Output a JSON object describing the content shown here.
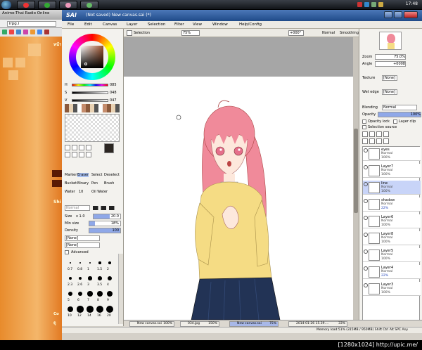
{
  "taskbar": {
    "clock": "17:48"
  },
  "browser": {
    "tab_title": "Anime-Thai Radio Online",
    "address": "irpg.i",
    "page_heading": "หน้า",
    "side_label": "Shi",
    "footer_labels": [
      "Co",
      "ดู"
    ]
  },
  "sai": {
    "logo": "SAI",
    "title": "(Not saved) New canvas.sai (*)",
    "menu": [
      "File",
      "Edit",
      "Canvas",
      "Layer",
      "Selection",
      "Filter",
      "View",
      "Window",
      "Help/Config"
    ],
    "toolbar": {
      "selection_label": "Selection",
      "zoom": "75%",
      "angle": "+000°",
      "mode": "Normal",
      "smoothing_label": "Smoothing",
      "smoothing_value": "14"
    },
    "color": {
      "h_label": "H",
      "h_value": "085",
      "s_label": "S",
      "s_value": "048",
      "v_label": "V",
      "v_value": "047"
    },
    "tools": {
      "row1": [
        "Marker",
        "Eraser",
        "Select",
        "Deselect"
      ],
      "row2": [
        "Bucket",
        "Binary",
        "Pen",
        "Brush"
      ],
      "row3": [
        "Water",
        "10",
        "Oil Water"
      ],
      "mode": "Normal"
    },
    "brush": {
      "size_label": "Size",
      "size_mult": "x 1.0",
      "size_value": "20.0",
      "min_label": "Min size",
      "min_value": "18%",
      "density_label": "Density",
      "density_value": "100",
      "tex1": "[None]",
      "tex2": "[None]",
      "advanced": "Advanced",
      "dot_labels": [
        "0.7",
        "0.8",
        "1",
        "1.5",
        "2",
        "2.3",
        "2.6",
        "3",
        "3.5",
        "4",
        "5",
        "6",
        "7",
        "8",
        "9",
        "10",
        "12",
        "14",
        "16",
        "20"
      ]
    },
    "right": {
      "zoom_label": "Zoom",
      "zoom_value": "75.0%",
      "angle_label": "Angle",
      "angle_value": "+0008",
      "texture_label": "Texture",
      "texture_value": "[None]",
      "wet_label": "Wet edge",
      "wet_value": "[None]",
      "blend_label": "Blending",
      "blend_value": "Normal",
      "opacity_label": "Opacity",
      "opacity_value": "100%",
      "opacity_lock": "Opacity lock",
      "layer_clip": "Layer clip",
      "selection_source": "Selection source"
    },
    "layers": [
      {
        "name": "eyes",
        "mode": "Normal",
        "opacity": "100%",
        "sel": false,
        "blue": false
      },
      {
        "name": "Layer7",
        "mode": "Normal",
        "opacity": "100%",
        "sel": false,
        "blue": false
      },
      {
        "name": "line",
        "mode": "Normal",
        "opacity": "100%",
        "sel": true,
        "blue": false
      },
      {
        "name": "shadow",
        "mode": "Normal",
        "opacity": "22%",
        "sel": false,
        "blue": true
      },
      {
        "name": "Layer6",
        "mode": "Normal",
        "opacity": "100%",
        "sel": false,
        "blue": false
      },
      {
        "name": "Layer8",
        "mode": "Normal",
        "opacity": "100%",
        "sel": false,
        "blue": false
      },
      {
        "name": "Layer5",
        "mode": "Normal",
        "opacity": "100%",
        "sel": false,
        "blue": false
      },
      {
        "name": "Layer4",
        "mode": "Normal",
        "opacity": "22%",
        "sel": false,
        "blue": true
      },
      {
        "name": "Layer3",
        "mode": "Normal",
        "opacity": "100%",
        "sel": false,
        "blue": false
      }
    ],
    "file_tabs": [
      {
        "name": "New canvas.sai",
        "pct": "100%",
        "active": false
      },
      {
        "name": "034.jpg",
        "pct": "150%",
        "active": false
      },
      {
        "name": "New canvas.sai",
        "pct": "75%",
        "active": true
      },
      {
        "name": "2014-01-26 15.39....",
        "pct": "33%",
        "active": false
      }
    ],
    "status": "Memory load:51% (315MB / 950MB)   Shift Ctrl Alt SPC Any"
  },
  "watermark": "[1280x1024] http://upic.me/",
  "colors": {
    "hair": "#f08a9a",
    "sweater": "#f5dc84",
    "skirt": "#223355",
    "accent": "#2244bb"
  }
}
